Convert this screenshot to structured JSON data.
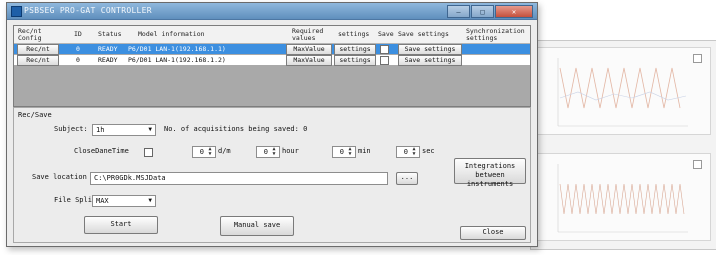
{
  "window": {
    "title": "PSBSEG PRO-GAT CONTROLLER",
    "minimize_label": "",
    "maximize_label": "",
    "close_label": ""
  },
  "grid": {
    "headers": {
      "rec_info": "Rec/nt Config",
      "id": "ID",
      "status": "Status",
      "model_info": "Model information",
      "required_values": "Required values",
      "settings": "settings",
      "save": "Save",
      "save_settings": "Save settings",
      "synchronization": "Synchronization settings"
    },
    "rows": [
      {
        "rec_button": "Rec/nt",
        "id": "0",
        "status": "READY",
        "model": "P6/D01 LAN-1(192.168.1.1)",
        "required_button": "MaxValue",
        "settings_button": "settings",
        "save_settings_button": "Save settings",
        "selected": true
      },
      {
        "rec_button": "Rec/nt",
        "id": "0",
        "status": "READY",
        "model": "P6/D01 LAN-1(192.168.1.2)",
        "required_button": "MaxValue",
        "settings_button": "settings",
        "save_settings_button": "Save settings",
        "selected": false
      }
    ]
  },
  "form": {
    "group_title": "Rec/Save",
    "subject_label": "Subject:",
    "subject_value": "1h",
    "num_acquisitions_label": "No. of acquisitions being saved: 0",
    "close_data_label": "CloseDaneTime",
    "time": {
      "days_value": "0",
      "days_unit": "d/m",
      "hours_value": "0",
      "hours_unit": "hour",
      "minutes_value": "0",
      "minutes_unit": "min",
      "seconds_value": "0",
      "seconds_unit": "sec"
    },
    "save_location_label": "Save location",
    "save_location_value": "C:\\PR0GDk.MSJData",
    "browse_label": "...",
    "file_split_label": "File Split",
    "file_split_value": "MAX",
    "start_button": "Start",
    "manual_save_button": "Manual save",
    "sync_button": "Integrations between instruments",
    "close_button": "Close"
  }
}
